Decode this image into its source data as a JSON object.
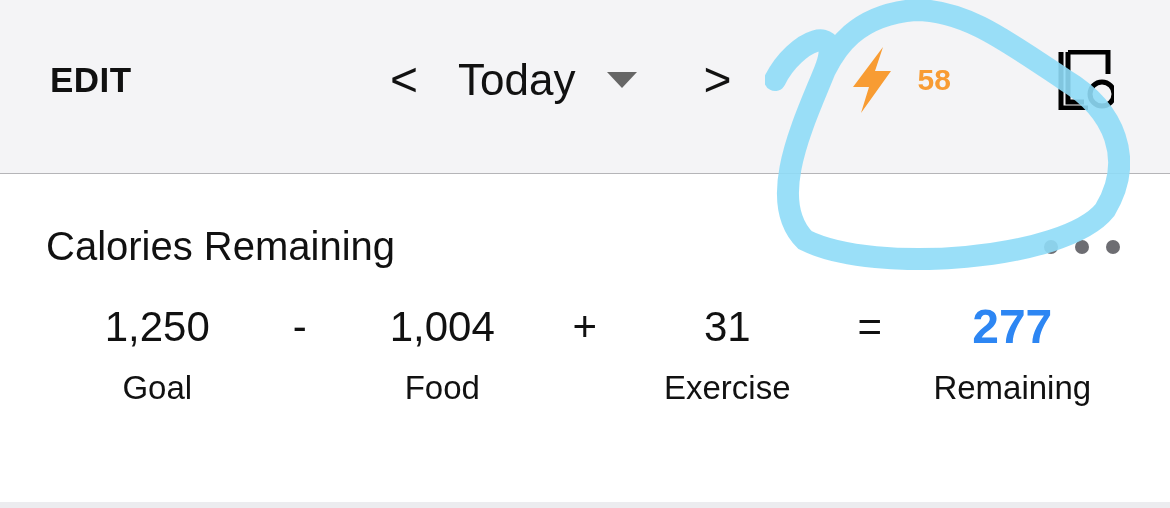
{
  "header": {
    "edit": "EDIT",
    "prev": "<",
    "date": "Today",
    "next": ">",
    "streak": "58"
  },
  "card": {
    "title": "Calories Remaining",
    "equation": [
      {
        "kind": "term",
        "value": "1,250",
        "label": "Goal",
        "highlight": false
      },
      {
        "kind": "operator",
        "value": "-"
      },
      {
        "kind": "term",
        "value": "1,004",
        "label": "Food",
        "highlight": false
      },
      {
        "kind": "operator",
        "value": "+"
      },
      {
        "kind": "term",
        "value": "31",
        "label": "Exercise",
        "highlight": false
      },
      {
        "kind": "operator",
        "value": "="
      },
      {
        "kind": "term",
        "value": "277",
        "label": "Remaining",
        "highlight": true
      }
    ]
  }
}
